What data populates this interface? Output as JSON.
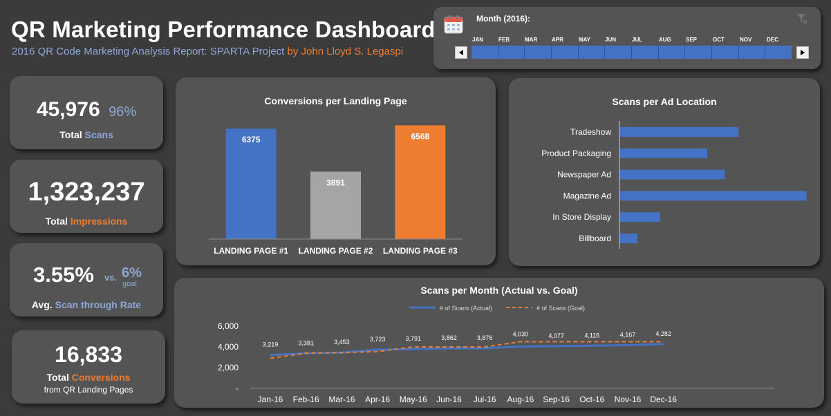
{
  "header": {
    "title": "QR Marketing Performance Dashboard",
    "subtitle_main": "2016 QR Code Marketing Analysis Report: SPARTA Project",
    "subtitle_author": "by John Lloyd S. Legaspi"
  },
  "timeline": {
    "label": "Month (2016):",
    "months": [
      "JAN",
      "FEB",
      "MAR",
      "APR",
      "MAY",
      "JUN",
      "JUL",
      "AUG",
      "SEP",
      "OCT",
      "NOV",
      "DEC"
    ],
    "prev_icon": "triangle-left-icon",
    "next_icon": "triangle-right-icon",
    "calendar_icon": "calendar-icon",
    "clear_filter_icon": "clear-filter-icon"
  },
  "kpis": {
    "scans": {
      "value": "45,976",
      "pct": "96%",
      "label_a": "Total",
      "label_b": "Scans"
    },
    "impressions": {
      "value": "1,323,237",
      "label_a": "Total",
      "label_b": "Impressions"
    },
    "rate": {
      "value": "3.55%",
      "vs": "vs.",
      "goal_value": "6%",
      "goal_label": "goal",
      "label_a": "Avg.",
      "label_b": "Scan through Rate"
    },
    "conversions": {
      "value": "16,833",
      "label_a": "Total",
      "label_b": "Conversions",
      "label_c": "from QR Landing Pages"
    }
  },
  "colors": {
    "blue": "#4472c4",
    "gray": "#a5a5a5",
    "orange": "#ed7d31",
    "card": "#545454",
    "background": "#3b3b3b"
  },
  "chart_data": [
    {
      "type": "bar",
      "title": "Conversions per Landing Page",
      "categories": [
        "LANDING PAGE #1",
        "LANDING PAGE #2",
        "LANDING PAGE #3"
      ],
      "values": [
        6375,
        3891,
        6568
      ],
      "bar_colors": [
        "#4472c4",
        "#a5a5a5",
        "#ed7d31"
      ],
      "ylim": [
        0,
        7000
      ]
    },
    {
      "type": "bar",
      "orientation": "horizontal",
      "title": "Scans per Ad Location",
      "categories": [
        "Tradeshow",
        "Product Packaging",
        "Newspaper Ad",
        "Magazine Ad",
        "In Store Display",
        "Billboard"
      ],
      "values": [
        6800,
        5000,
        6000,
        10700,
        2300,
        1000
      ],
      "xlim": [
        0,
        12000
      ]
    },
    {
      "type": "line",
      "title": "Scans per Month (Actual vs. Goal)",
      "categories": [
        "Jan-16",
        "Feb-16",
        "Mar-16",
        "Apr-16",
        "May-16",
        "Jun-16",
        "Jul-16",
        "Aug-16",
        "Sep-16",
        "Oct-16",
        "Nov-16",
        "Dec-16"
      ],
      "series": [
        {
          "name": "# of Scans (Actual)",
          "values": [
            3219,
            3381,
            3453,
            3723,
            3791,
            3862,
            3876,
            4030,
            4077,
            4115,
            4167,
            4282
          ],
          "color": "#4472c4",
          "style": "solid"
        },
        {
          "name": "# of Scans (Goal)",
          "values": [
            2900,
            3400,
            3450,
            3550,
            4000,
            4000,
            4000,
            4500,
            4500,
            4500,
            4500,
            4500
          ],
          "color": "#ed7d31",
          "style": "dashed"
        }
      ],
      "data_labels": [
        "3,219",
        "3,381",
        "3,453",
        "3,723",
        "3,791",
        "3,862",
        "3,876",
        "4,030",
        "4,077",
        "4,115",
        "4,167",
        "4,282"
      ],
      "y_ticks": [
        "-",
        "2,000",
        "4,000",
        "6,000"
      ],
      "ylim": [
        0,
        6000
      ]
    }
  ]
}
